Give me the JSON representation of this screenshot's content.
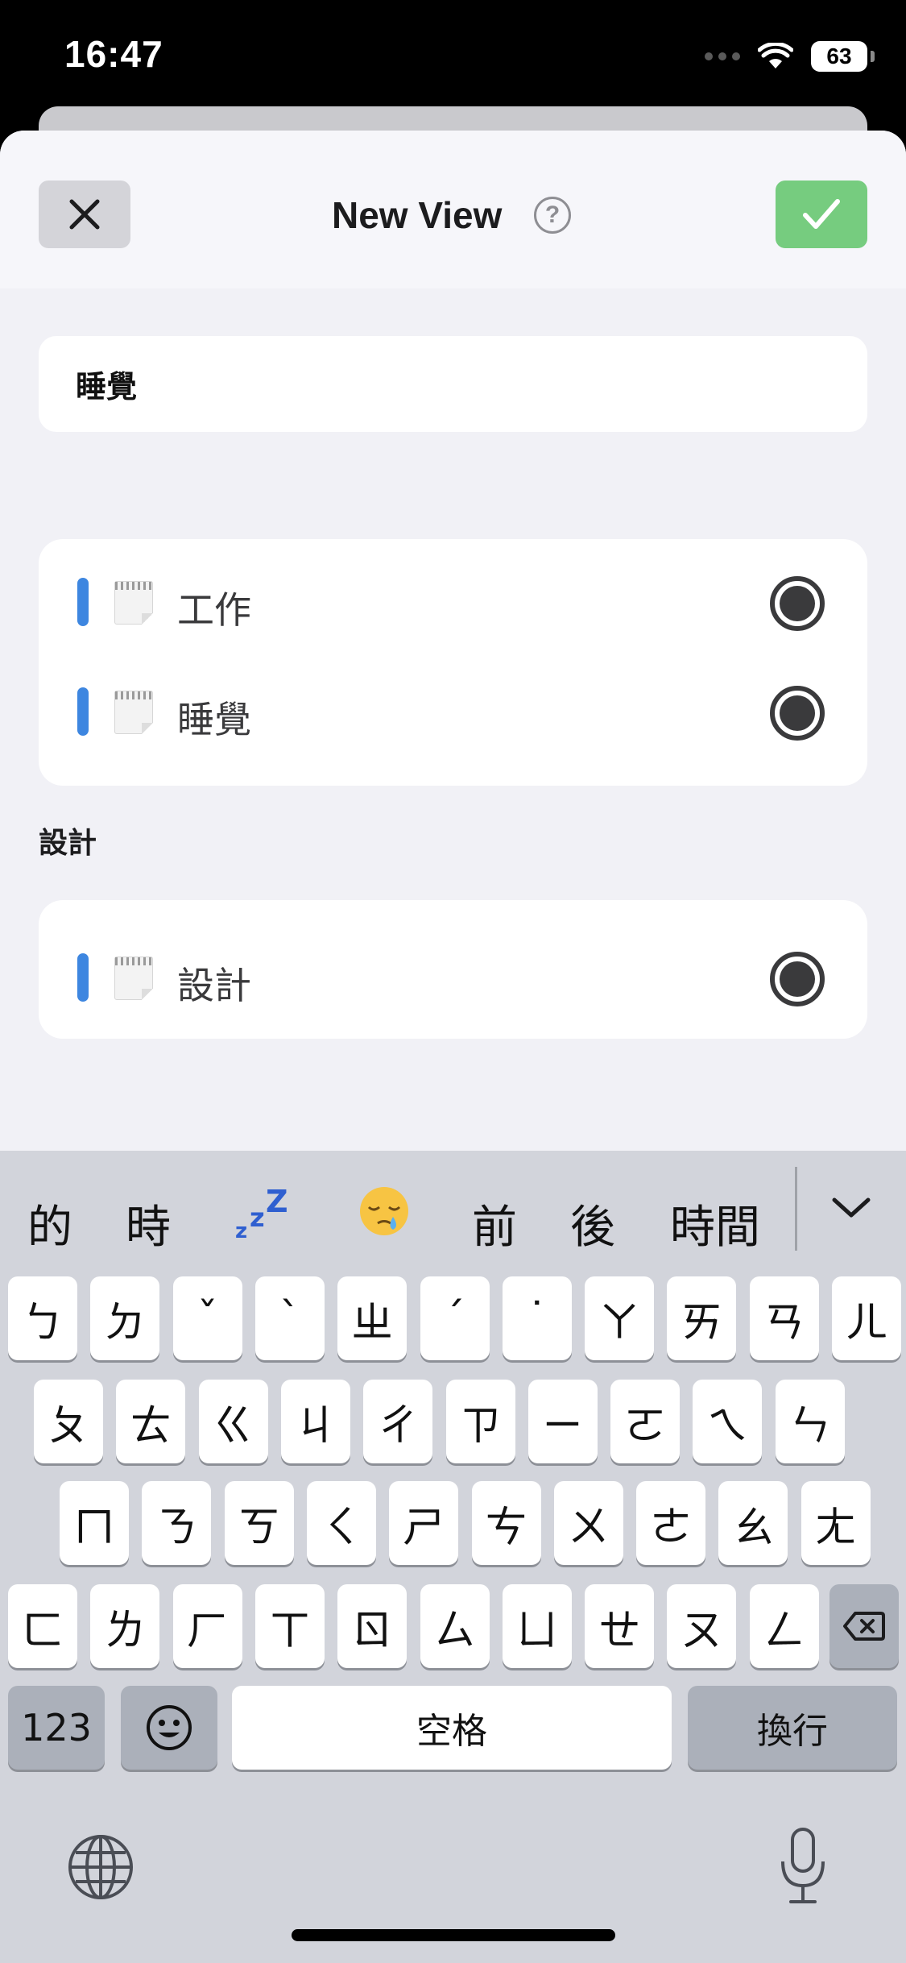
{
  "status_bar": {
    "time": "16:47",
    "battery": "63"
  },
  "nav": {
    "title": "New View",
    "help_glyph": "?",
    "close_icon": "close-icon",
    "confirm_icon": "checkmark-icon"
  },
  "view_name": {
    "value": "睡覺"
  },
  "group1": {
    "items": [
      {
        "label": "工作",
        "selected": true
      },
      {
        "label": "睡覺",
        "selected": true
      }
    ]
  },
  "group2": {
    "header": "設計",
    "items": [
      {
        "label": "設計",
        "selected": true
      }
    ]
  },
  "keyboard": {
    "candidates": [
      "的",
      "時",
      "zzZ",
      "😪",
      "前",
      "後",
      "時間"
    ],
    "rows": [
      [
        "ㄅ",
        "ㄉ",
        "ˇ",
        "ˋ",
        "ㄓ",
        "ˊ",
        "˙",
        "ㄚ",
        "ㄞ",
        "ㄢ",
        "ㄦ"
      ],
      [
        "ㄆ",
        "ㄊ",
        "ㄍ",
        "ㄐ",
        "ㄔ",
        "ㄗ",
        "ㄧ",
        "ㄛ",
        "ㄟ",
        "ㄣ"
      ],
      [
        "ㄇ",
        "ㄋ",
        "ㄎ",
        "ㄑ",
        "ㄕ",
        "ㄘ",
        "ㄨ",
        "ㄜ",
        "ㄠ",
        "ㄤ"
      ],
      [
        "ㄈ",
        "ㄌ",
        "ㄏ",
        "ㄒ",
        "ㄖ",
        "ㄙ",
        "ㄩ",
        "ㄝ",
        "ㄡ",
        "ㄥ"
      ]
    ],
    "numbers_key": "123",
    "space_key": "空格",
    "return_key": "換行"
  },
  "colors": {
    "accent_bar": "#3d86e0",
    "confirm_bg": "#76cc7f"
  }
}
